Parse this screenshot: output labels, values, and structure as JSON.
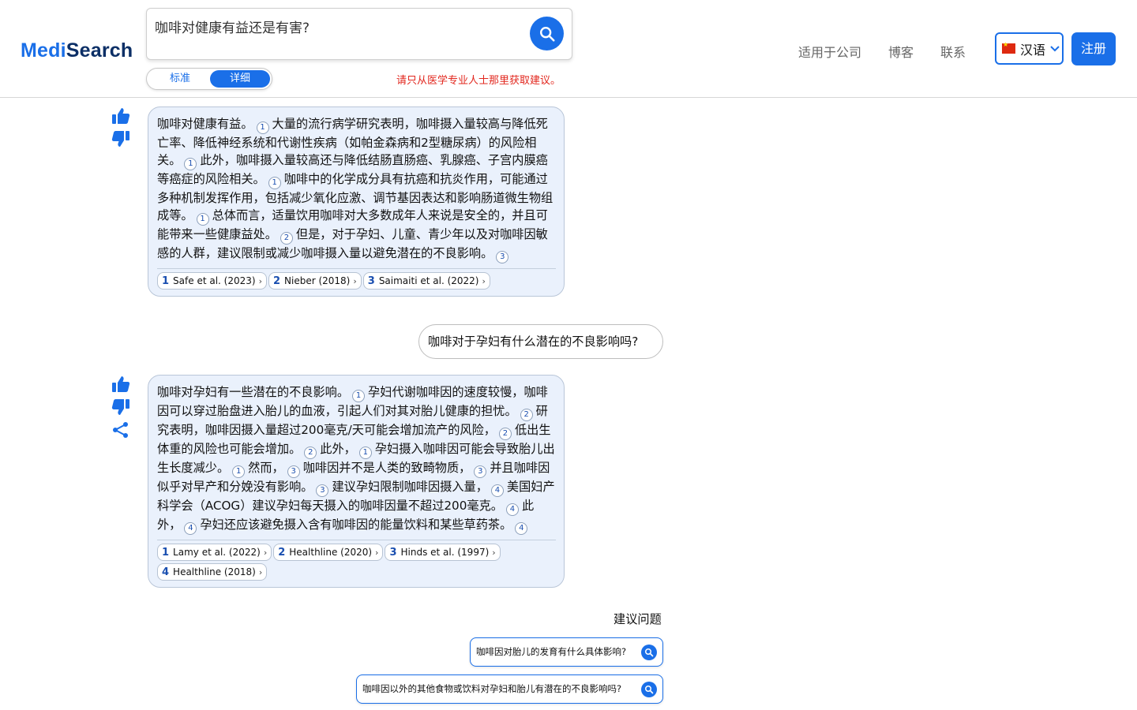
{
  "header": {
    "logo_part1": "Medi",
    "logo_part2": "Search",
    "search": {
      "value": "咖啡对健康有益还是有害?"
    },
    "mode_standard": "标准",
    "mode_detailed": "详细",
    "disclaimer": "请只从医学专业人士那里获取建议。",
    "nav": {
      "company": "适用于公司",
      "blog": "博客",
      "contact": "联系"
    },
    "language": "汉语",
    "signup": "注册"
  },
  "chat": {
    "answer1": {
      "segments": [
        "咖啡对健康有益。",
        "大量的流行病学研究表明，咖啡摄入量较高与降低死亡率、降低神经系统和代谢性疾病（如帕金森病和2型糖尿病）的风险相关。",
        "此外，咖啡摄入量较高还与降低结肠直肠癌、乳腺癌、子宫内膜癌等癌症的风险相关。",
        "咖啡中的化学成分具有抗癌和抗炎作用，可能通过多种机制发挥作用，包括减少氧化应激、调节基因表达和影响肠道微生物组成等。",
        "总体而言，适量饮用咖啡对大多数成年人来说是安全的，并且可能带来一些健康益处。",
        "但是，对于孕妇、儿童、青少年以及对咖啡因敏感的人群，建议限制或减少咖啡摄入量以避免潜在的不良影响。"
      ],
      "cites": [
        "1",
        "1",
        "1",
        "1",
        "2",
        "3"
      ],
      "refs": [
        {
          "num": "1",
          "label": "Safe et al. (2023)"
        },
        {
          "num": "2",
          "label": "Nieber (2018)"
        },
        {
          "num": "3",
          "label": "Saimaiti et al. (2022)"
        }
      ]
    },
    "user_question": "咖啡对于孕妇有什么潜在的不良影响吗?",
    "answer2": {
      "segments": [
        "咖啡对孕妇有一些潜在的不良影响。",
        "孕妇代谢咖啡因的速度较慢，咖啡因可以穿过胎盘进入胎儿的血液，引起人们对其对胎儿健康的担忧。",
        "研究表明，咖啡因摄入量超过200毫克/天可能会增加流产的风险，",
        "低出生体重的风险也可能会增加。",
        "此外，",
        "孕妇摄入咖啡因可能会导致胎儿出生长度减少。",
        "然而，",
        "咖啡因并不是人类的致畸物质，",
        "并且咖啡因似乎对早产和分娩没有影响。",
        "建议孕妇限制咖啡因摄入量，",
        "美国妇产科学会（ACOG）建议孕妇每天摄入的咖啡因量不超过200毫克。",
        "此外，",
        "孕妇还应该避免摄入含有咖啡因的能量饮料和某些草药茶。"
      ],
      "cites": [
        "1",
        "2",
        "2",
        "2",
        "1",
        "1",
        "3",
        "3",
        "3",
        "4",
        "4",
        "4",
        "4"
      ],
      "refs": [
        {
          "num": "1",
          "label": "Lamy et al. (2022)"
        },
        {
          "num": "2",
          "label": "Healthline (2020)"
        },
        {
          "num": "3",
          "label": "Hinds et al. (1997)"
        },
        {
          "num": "4",
          "label": "Healthline (2018)"
        }
      ]
    }
  },
  "suggestions": {
    "title": "建议问题",
    "items": [
      "咖啡因对胎儿的发育有什么具体影响?",
      "咖啡因以外的其他食物或饮料对孕妇和胎儿有潜在的不良影响吗?"
    ]
  },
  "colors": {
    "accent": "#1a6fe8",
    "warning": "#e2271e",
    "answer_bg": "#eaf1fc"
  }
}
